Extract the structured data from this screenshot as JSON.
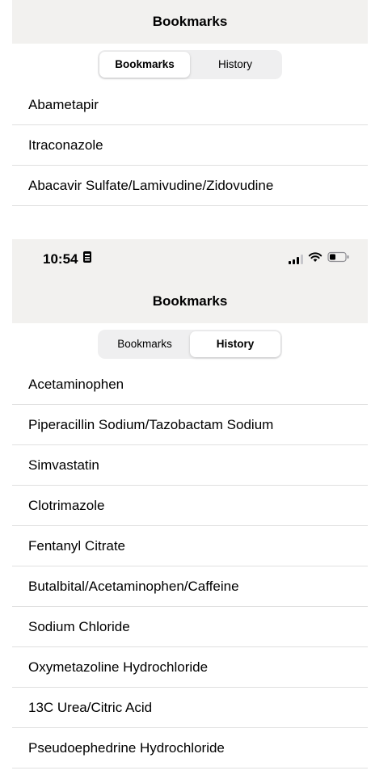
{
  "top": {
    "nav_title": "Bookmarks",
    "segments": [
      {
        "label": "Bookmarks",
        "active": true
      },
      {
        "label": "History",
        "active": false
      }
    ],
    "items": [
      "Abametapir",
      "Itraconazole",
      "Abacavir Sulfate/Lamivudine/Zidovudine"
    ]
  },
  "bottom": {
    "status": {
      "time": "10:54",
      "icons": [
        "badge-icon",
        "signal-icon",
        "wifi-icon",
        "battery-icon"
      ]
    },
    "nav_title": "Bookmarks",
    "segments": [
      {
        "label": "Bookmarks",
        "active": false
      },
      {
        "label": "History",
        "active": true
      }
    ],
    "items": [
      "Acetaminophen",
      "Piperacillin Sodium/Tazobactam Sodium",
      "Simvastatin",
      "Clotrimazole",
      "Fentanyl Citrate",
      "Butalbital/Acetaminophen/Caffeine",
      "Sodium Chloride",
      "Oxymetazoline Hydrochloride",
      "13C Urea/Citric Acid",
      "Pseudoephedrine Hydrochloride"
    ]
  },
  "colors": {
    "nav_background": "#f2f1ef",
    "segment_track": "#efeff0",
    "segment_active": "#ffffff",
    "separator": "#e0e0e0"
  }
}
